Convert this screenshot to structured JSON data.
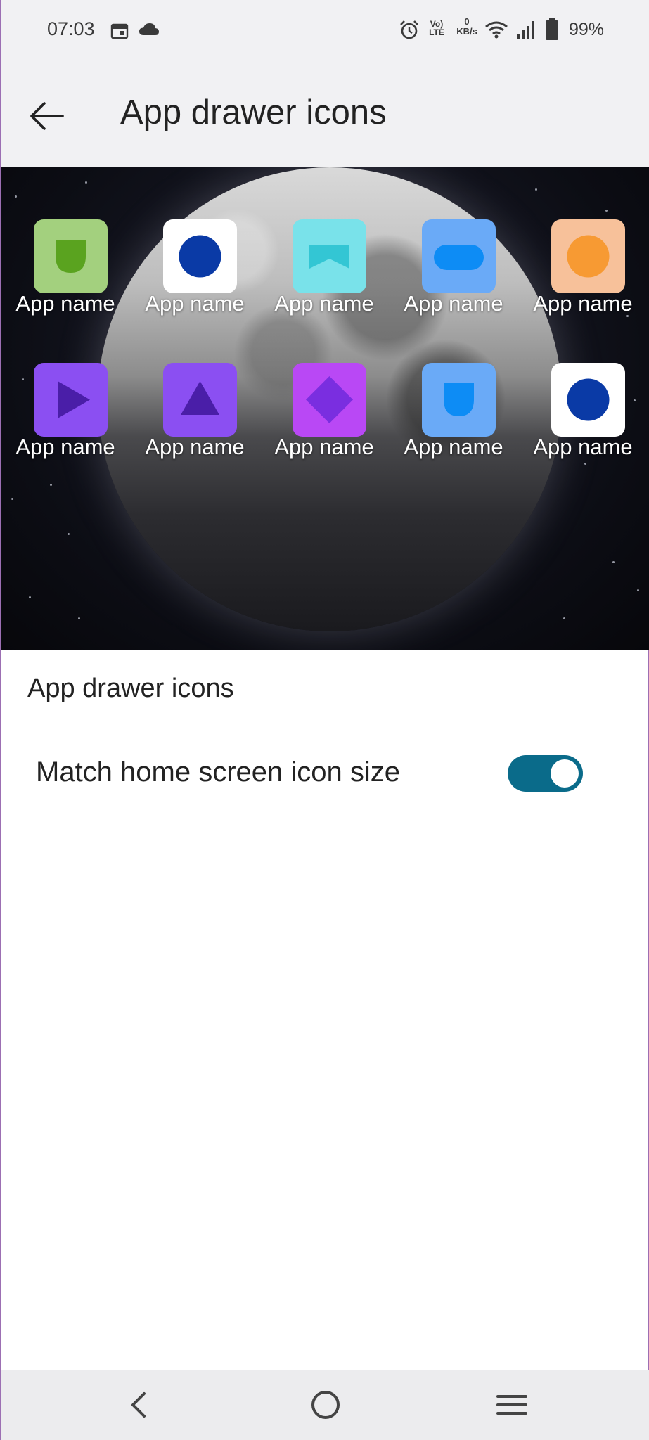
{
  "status_bar": {
    "time": "07:03",
    "calendar_icon": "calendar-icon",
    "cloud_icon": "cloud-icon",
    "alarm_icon": "alarm-icon",
    "volte_label": "Vo) LTE",
    "data_rate_value": "0",
    "data_rate_unit": "KB/s",
    "wifi_icon": "wifi-icon",
    "signal_icon": "signal-icon",
    "battery_icon": "battery-icon",
    "battery_percent": "99%"
  },
  "app_bar": {
    "back_icon": "back-arrow-icon",
    "title": "App drawer icons"
  },
  "preview": {
    "apps": [
      {
        "label": "App name",
        "bg": "#a3d07e",
        "shape": "shield",
        "fg": "#5aa31f"
      },
      {
        "label": "App name",
        "bg": "#ffffff",
        "shape": "circle",
        "fg": "#0a3aa6"
      },
      {
        "label": "App name",
        "bg": "#79e2ea",
        "shape": "banner",
        "fg": "#33c6d4"
      },
      {
        "label": "App name",
        "bg": "#6aaaf7",
        "shape": "pill",
        "fg": "#0d8cf5"
      },
      {
        "label": "App name",
        "bg": "#f7c19a",
        "shape": "circle",
        "fg": "#f79a33"
      },
      {
        "label": "App name",
        "bg": "#8b4ff2",
        "shape": "play",
        "fg": "#4a1ea8"
      },
      {
        "label": "App name",
        "bg": "#8b4ff2",
        "shape": "triangle",
        "fg": "#4a1ea8"
      },
      {
        "label": "App name",
        "bg": "#b948f5",
        "shape": "diamond",
        "fg": "#7a2ee0"
      },
      {
        "label": "App name",
        "bg": "#6aaaf7",
        "shape": "shield",
        "fg": "#0d8cf5"
      },
      {
        "label": "App name",
        "bg": "#ffffff",
        "shape": "circle",
        "fg": "#0a3aa6"
      }
    ]
  },
  "section": {
    "title": "App drawer icons"
  },
  "settings": {
    "match_label": "Match home screen icon size",
    "match_enabled": true,
    "toggle_color": "#0a6b8a"
  },
  "nav_bar": {
    "back_icon": "nav-back-icon",
    "home_icon": "nav-home-icon",
    "menu_icon": "nav-menu-icon"
  }
}
